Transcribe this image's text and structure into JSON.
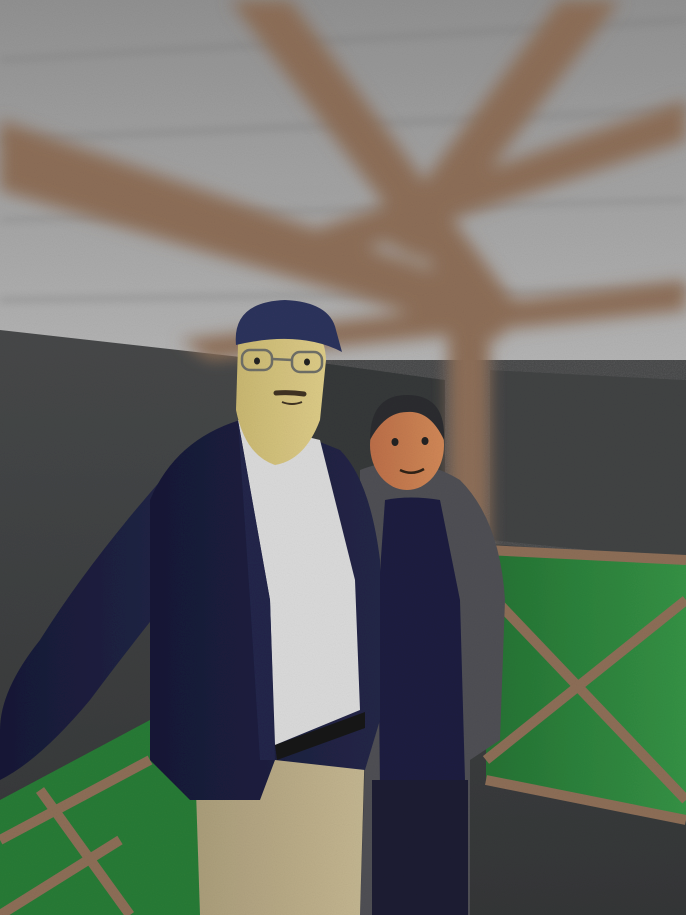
{
  "scene": {
    "subjects": [
      "man",
      "woman"
    ],
    "colors": {
      "ceiling": "#9c9c9c",
      "wall": "#3f4142",
      "beam": "#8a6a52",
      "fence": "#2f8f3f",
      "jacket": "#141633",
      "shirt": "#dcdcdc",
      "trousers": "#b2a47f",
      "cap": "#272d57",
      "man_skin": "#d4c27a",
      "woman_skin": "#c7744a",
      "woman_coat": "#4a4a4f"
    }
  }
}
